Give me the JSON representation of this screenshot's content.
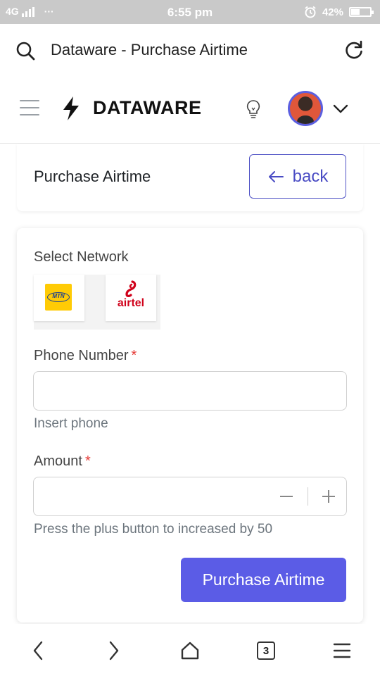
{
  "status_bar": {
    "network": "4G",
    "dots": "···",
    "time": "6:55 pm",
    "battery": "42%",
    "battery_level": 0.42
  },
  "browser": {
    "page_title": "Dataware - Purchase Airtime",
    "tabs_count": "3"
  },
  "header": {
    "brand": "DATAWARE"
  },
  "page": {
    "title": "Purchase Airtime",
    "back_label": "back"
  },
  "form": {
    "network_label": "Select Network",
    "networks": [
      {
        "name": "MTN",
        "logo_text": "MTN",
        "brand_color": "#ffcb05"
      },
      {
        "name": "airtel",
        "logo_text": "airtel",
        "brand_color": "#d0021b"
      }
    ],
    "phone_label": "Phone Number",
    "phone_value": "",
    "phone_hint": "Insert phone",
    "amount_label": "Amount",
    "amount_value": "",
    "amount_hint": "Press the plus button to increased by 50",
    "required_mark": "*",
    "submit_label": "Purchase Airtime"
  },
  "colors": {
    "accent": "#5b5ce6",
    "back_border": "#5154c6",
    "required": "#e53935"
  }
}
